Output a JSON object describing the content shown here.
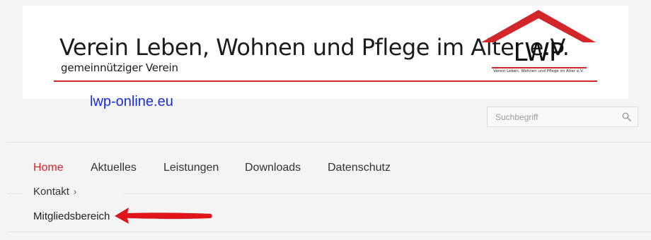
{
  "header": {
    "title": "Verein Leben, Wohnen und Pflege im Alter e.V.",
    "subtitle": "gemeinnütziger Verein",
    "logo": {
      "letters": "LWP",
      "caption": "Verein Leben, Wohnen und Pflege im Alter e.V.",
      "roof_color": "#d3262b"
    }
  },
  "site_link": "lwp-online.eu",
  "search": {
    "placeholder": "Suchbegriff",
    "icon": "search-icon"
  },
  "nav": {
    "home": "Home",
    "aktuelles": "Aktuelles",
    "leistungen": "Leistungen",
    "downloads": "Downloads",
    "datenschutz": "Datenschutz",
    "kontakt": "Kontakt",
    "kontakt_chevron": "›",
    "mitgliedsbereich": "Mitgliedsbereich",
    "active_color": "#d3262b"
  },
  "annotation": {
    "arrow_color": "#e0141b",
    "points_to": "mitgliedsbereich"
  },
  "colors": {
    "accent": "#d3262b",
    "link": "#1a2fd6",
    "background": "#f4f4f4"
  }
}
